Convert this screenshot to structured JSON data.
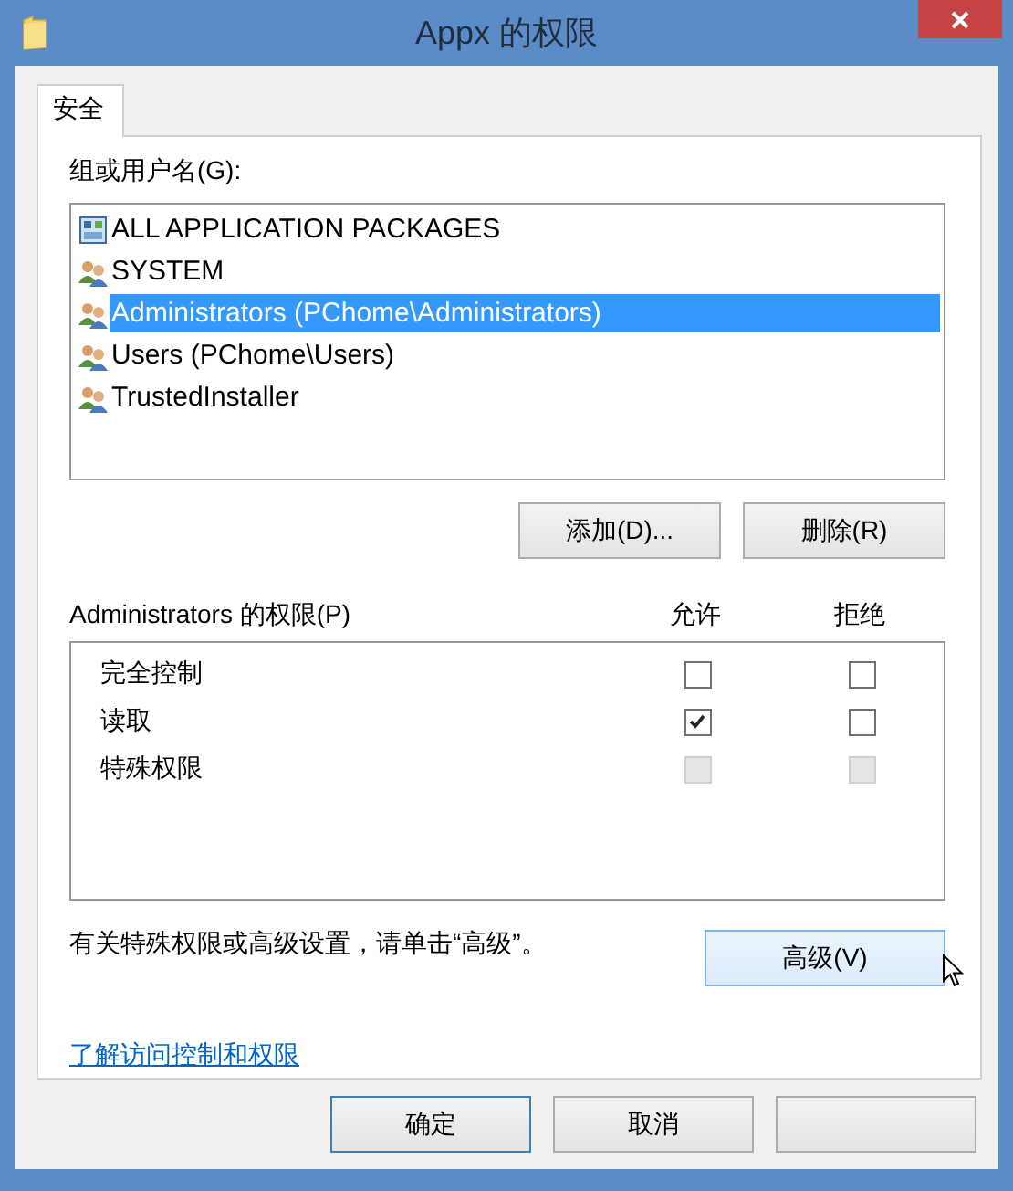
{
  "window": {
    "title": "Appx 的权限"
  },
  "tabs": [
    {
      "label": "安全",
      "selected": true
    }
  ],
  "group_label": "组或用户名(G):",
  "principals": [
    {
      "name": "ALL APPLICATION PACKAGES",
      "kind": "package",
      "selected": false
    },
    {
      "name": "SYSTEM",
      "kind": "group",
      "selected": false
    },
    {
      "name": "Administrators (PChome\\Administrators)",
      "kind": "group",
      "selected": true
    },
    {
      "name": "Users (PChome\\Users)",
      "kind": "group",
      "selected": false
    },
    {
      "name": "TrustedInstaller",
      "kind": "group",
      "selected": false
    }
  ],
  "principal_buttons": [
    "添加(D)...",
    "删除(R)"
  ],
  "permissions_label": "Administrators 的权限(P)",
  "columns": [
    "允许",
    "拒绝"
  ],
  "permissions": [
    {
      "name": "完全控制",
      "allow": {
        "checked": false,
        "disabled": false
      },
      "deny": {
        "checked": false,
        "disabled": false
      }
    },
    {
      "name": "读取",
      "allow": {
        "checked": true,
        "disabled": false
      },
      "deny": {
        "checked": false,
        "disabled": false
      }
    },
    {
      "name": "特殊权限",
      "allow": {
        "checked": false,
        "disabled": true
      },
      "deny": {
        "checked": false,
        "disabled": true
      }
    }
  ],
  "advanced_hint": "有关特殊权限或高级设置，请单击“高级”。",
  "advanced_button": "高级(V)",
  "help_link": "了解访问控制和权限",
  "dialog_buttons": [
    {
      "kind": "labeled",
      "label": "确定",
      "default": true
    },
    {
      "kind": "labeled",
      "label": "取消",
      "default": false
    },
    {
      "kind": "covered"
    }
  ]
}
